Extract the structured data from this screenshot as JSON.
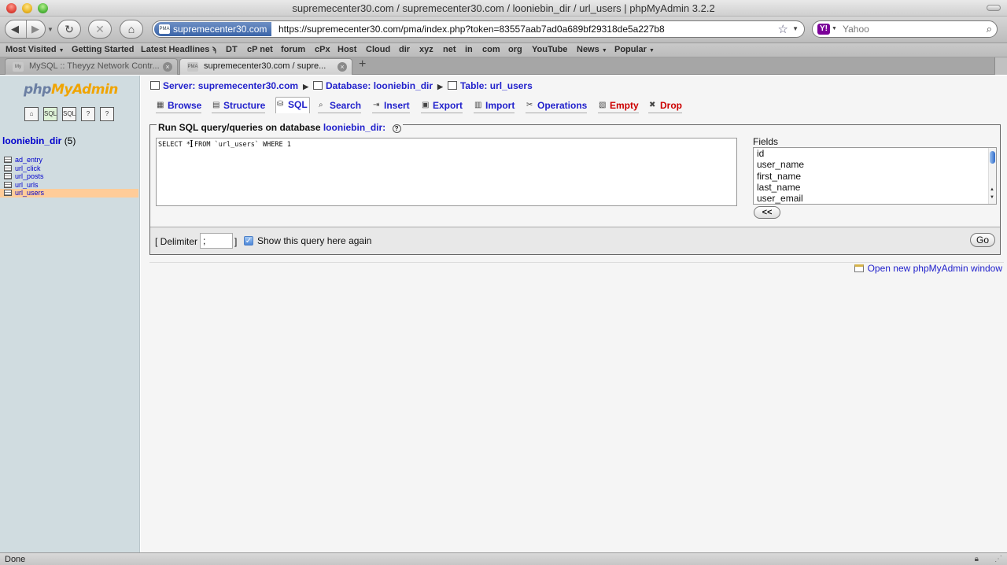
{
  "window": {
    "title": "supremecenter30.com / supremecenter30.com / looniebin_dir / url_users | phpMyAdmin 3.2.2"
  },
  "toolbar": {
    "site_identity": "supremecenter30.com",
    "url": "https://supremecenter30.com/pma/index.php?token=83557aab7ad0a689bf29318de5a227b8",
    "search_placeholder": "Yahoo"
  },
  "bookmarks": [
    {
      "label": "Most Visited",
      "dropdown": true
    },
    {
      "label": "Getting Started"
    },
    {
      "label": "Latest Headlines",
      "feed": true
    },
    {
      "label": "DT"
    },
    {
      "label": "cP net"
    },
    {
      "label": "forum"
    },
    {
      "label": "cPx"
    },
    {
      "label": "Host"
    },
    {
      "label": "Cloud"
    },
    {
      "label": "dir"
    },
    {
      "label": "xyz"
    },
    {
      "label": "net"
    },
    {
      "label": "in"
    },
    {
      "label": "com"
    },
    {
      "label": "org"
    },
    {
      "label": "YouTube"
    },
    {
      "label": "News",
      "dropdown": true
    },
    {
      "label": "Popular",
      "dropdown": true
    }
  ],
  "tabs": [
    {
      "label": "MySQL :: Theyyz Network Contr...",
      "active": false
    },
    {
      "label": "supremecenter30.com / supre...",
      "active": true
    }
  ],
  "sidebar": {
    "logo_php": "php",
    "logo_myadmin": "MyAdmin",
    "database": "looniebin_dir",
    "database_count": "(5)",
    "tables": [
      {
        "label": "ad_entry",
        "selected": false
      },
      {
        "label": "url_click",
        "selected": false
      },
      {
        "label": "url_posts",
        "selected": false
      },
      {
        "label": "url_urls",
        "selected": false
      },
      {
        "label": "url_users",
        "selected": true
      }
    ]
  },
  "breadcrumb": {
    "server": "Server: supremecenter30.com",
    "database": "Database: looniebin_dir",
    "table": "Table: url_users"
  },
  "page_tabs": [
    {
      "label": "Browse",
      "icon": "browse-icon"
    },
    {
      "label": "Structure",
      "icon": "structure-icon"
    },
    {
      "label": "SQL",
      "icon": "sql-icon",
      "active": true
    },
    {
      "label": "Search",
      "icon": "search-icon"
    },
    {
      "label": "Insert",
      "icon": "insert-icon"
    },
    {
      "label": "Export",
      "icon": "export-icon"
    },
    {
      "label": "Import",
      "icon": "import-icon"
    },
    {
      "label": "Operations",
      "icon": "operations-icon"
    },
    {
      "label": "Empty",
      "icon": "empty-icon",
      "danger": true
    },
    {
      "label": "Drop",
      "icon": "drop-icon",
      "danger": true
    }
  ],
  "sql": {
    "legend_prefix": "Run SQL query/queries on database",
    "legend_db": "looniebin_dir:",
    "query": "SELECT * FROM `url_users` WHERE 1",
    "fields_label": "Fields",
    "fields": [
      "id",
      "user_name",
      "first_name",
      "last_name",
      "user_email"
    ],
    "insert_label": "<<",
    "delimiter_open": "[ Delimiter",
    "delimiter_value": ";",
    "delimiter_close": "]",
    "show_again_label": "Show this query here again",
    "show_again_checked": true,
    "go_label": "Go"
  },
  "open_new_window": "Open new phpMyAdmin window",
  "status": {
    "text": "Done"
  }
}
